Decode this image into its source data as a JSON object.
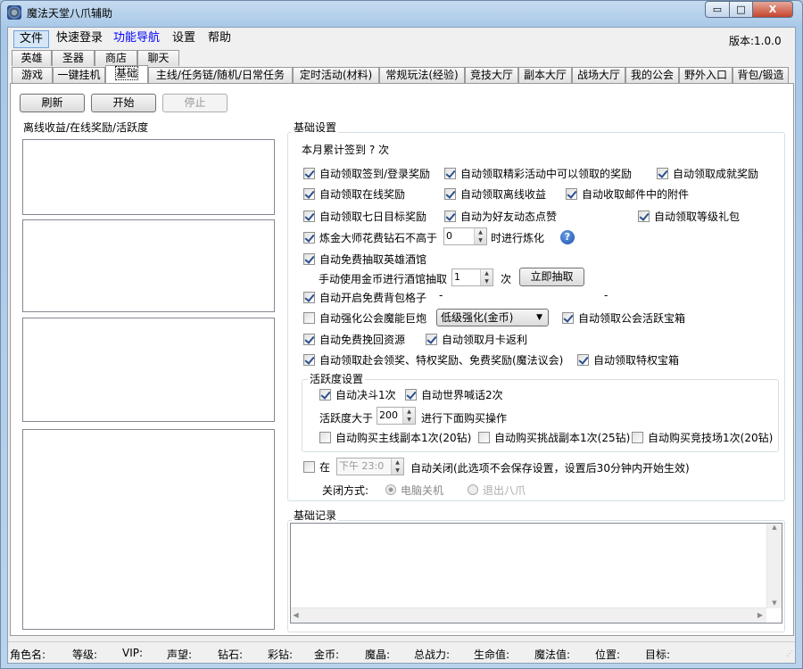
{
  "window": {
    "title": "魔法天堂八爪辅助",
    "min": "▭",
    "max": "□",
    "close": "X"
  },
  "menu": {
    "items": [
      "文件",
      "快速登录",
      "功能导航",
      "设置",
      "帮助"
    ],
    "version": "版本:1.0.0",
    "highlight_color": "#0000ff"
  },
  "tabs_row1": [
    "英雄",
    "圣器",
    "商店",
    "聊天"
  ],
  "tabs_row2": [
    "游戏",
    "一键挂机",
    "基础",
    "主线/任务链/随机/日常任务",
    "定时活动(材料)",
    "常规玩法(经验)",
    "竞技大厅",
    "副本大厅",
    "战场大厅",
    "我的公会",
    "野外入口",
    "背包/锻造"
  ],
  "active_tab": "基础",
  "toolbar": {
    "refresh": "刷新",
    "start": "开始",
    "stop": "停止"
  },
  "left_group": {
    "title": "离线收益/在线奖励/活跃度"
  },
  "basic": {
    "title": "基础设置",
    "signin": "本月累计签到 ? 次",
    "options": [
      {
        "label": "自动领取签到/登录奖励",
        "checked": true
      },
      {
        "label": "自动领取精彩活动中可以领取的奖励",
        "checked": true
      },
      {
        "label": "自动领取成就奖励",
        "checked": true
      },
      {
        "label": "自动领取在线奖励",
        "checked": true
      },
      {
        "label": "自动领取离线收益",
        "checked": true
      },
      {
        "label": "自动收取邮件中的附件",
        "checked": true
      },
      {
        "label": "自动领取七日目标奖励",
        "checked": true
      },
      {
        "label": "自动为好友动态点赞",
        "checked": true
      },
      {
        "label": "自动领取等级礼包",
        "checked": true
      },
      {
        "label": "炼金大师花费钻石不高于",
        "checked": true
      },
      {
        "label": "自动免费抽取英雄酒馆",
        "checked": true
      },
      {
        "label": "自动开启免费背包格子",
        "checked": true
      },
      {
        "label": "自动强化公会魔能巨炮",
        "checked": false
      },
      {
        "label": "自动领取公会活跃宝箱",
        "checked": true
      },
      {
        "label": "自动免费挽回资源",
        "checked": true
      },
      {
        "label": "自动领取月卡返利",
        "checked": true
      },
      {
        "label": "自动领取赴会领奖、特权奖励、免费奖励(魔法议会)",
        "checked": true
      },
      {
        "label": "自动领取特权宝箱",
        "checked": true
      }
    ],
    "alchemy_value": "0",
    "alchemy_suffix": "时进行炼化",
    "manual_label": "手动使用金币进行酒馆抽取",
    "manual_value": "1",
    "manual_unit": "次",
    "draw_now": "立即抽取",
    "dash1": "-",
    "dash2": "-",
    "cannon_select": "低级强化(金币)",
    "activity": {
      "title": "活跃度设置",
      "options": [
        {
          "label": "自动决斗1次",
          "checked": true
        },
        {
          "label": "自动世界喊话2次",
          "checked": true
        },
        {
          "label": "自动购买主线副本1次(20钻)",
          "checked": false
        },
        {
          "label": "自动购买挑战副本1次(25钻)",
          "checked": false
        },
        {
          "label": "自动购买竞技场1次(20钻)",
          "checked": false
        }
      ],
      "threshold_label": "活跃度大于",
      "threshold_value": "200",
      "threshold_suffix": "进行下面购买操作"
    },
    "shutdown": {
      "checked": false,
      "at": "在",
      "time": "下午 23:0",
      "desc": "自动关闭(此选项不会保存设置，设置后30分钟内开始生效)",
      "method_label": "关闭方式:",
      "methods": [
        {
          "label": "电脑关机",
          "selected": true
        },
        {
          "label": "退出八爪",
          "selected": false
        }
      ]
    }
  },
  "log": {
    "title": "基础记录"
  },
  "status": [
    "角色名:",
    "等级:",
    "VIP:",
    "声望:",
    "钻石:",
    "彩钻:",
    "金币:",
    "魔晶:",
    "总战力:",
    "生命值:",
    "魔法值:",
    "位置:",
    "目标:"
  ]
}
